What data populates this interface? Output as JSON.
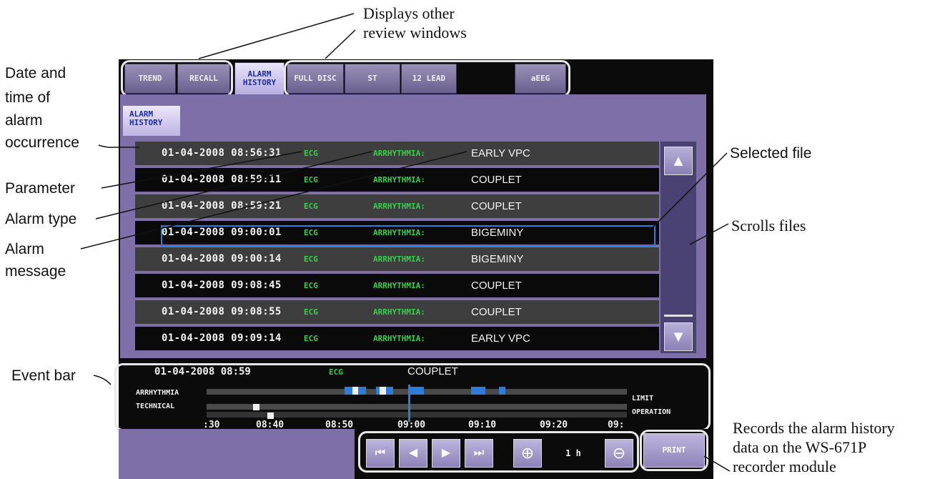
{
  "callouts": {
    "other_windows": [
      "Displays other",
      "review windows"
    ],
    "datetime": [
      "Date and",
      "time of",
      "alarm",
      "occurrence"
    ],
    "parameter": "Parameter",
    "alarm_type": "Alarm type",
    "alarm_message": [
      "Alarm",
      "message"
    ],
    "selected_file": "Selected file",
    "scrolls_files": "Scrolls files",
    "event_bar": "Event bar",
    "records": [
      "Records the alarm history",
      "data on the WS-671P",
      "recorder module"
    ]
  },
  "tabs": [
    {
      "label": "TREND"
    },
    {
      "label": "RECALL"
    },
    {
      "label": "ALARM HISTORY",
      "active": true
    },
    {
      "label": "FULL DISC"
    },
    {
      "label": "ST"
    },
    {
      "label": "12 LEAD"
    },
    {
      "label": ""
    },
    {
      "label": "aEEG"
    }
  ],
  "subtab": {
    "label": "ALARM HISTORY"
  },
  "alarm_rows": [
    {
      "datetime": "01-04-2008 08:56:31",
      "parameter": "ECG",
      "type": "ARRHYTHMIA:",
      "message": "EARLY VPC"
    },
    {
      "datetime": "01-04-2008 08:59:11",
      "parameter": "ECG",
      "type": "ARRHYTHMIA:",
      "message": "COUPLET"
    },
    {
      "datetime": "01-04-2008 08:59:21",
      "parameter": "ECG",
      "type": "ARRHYTHMIA:",
      "message": "COUPLET"
    },
    {
      "datetime": "01-04-2008 09:00:01",
      "parameter": "ECG",
      "type": "ARRHYTHMIA:",
      "message": "BIGEMINY",
      "selected": true
    },
    {
      "datetime": "01-04-2008 09:00:14",
      "parameter": "ECG",
      "type": "ARRHYTHMIA:",
      "message": "BIGEMINY"
    },
    {
      "datetime": "01-04-2008 09:08:45",
      "parameter": "ECG",
      "type": "ARRHYTHMIA:",
      "message": "COUPLET"
    },
    {
      "datetime": "01-04-2008 09:08:55",
      "parameter": "ECG",
      "type": "ARRHYTHMIA:",
      "message": "COUPLET"
    },
    {
      "datetime": "01-04-2008 09:09:14",
      "parameter": "ECG",
      "type": "ARRHYTHMIA:",
      "message": "EARLY VPC"
    }
  ],
  "scroll": {
    "up_icon": "triangle-up-icon",
    "down_icon": "triangle-down-icon"
  },
  "event_bar": {
    "header_datetime": "01-04-2008 08:59",
    "header_parameter": "ECG",
    "header_message": "COUPLET",
    "lane_left": [
      "ARRHYTHMIA",
      "TECHNICAL"
    ],
    "lane_right": [
      "LIMIT",
      "OPERATION"
    ],
    "time_labels": [
      ":30",
      "08:40",
      "08:50",
      "09:00",
      "09:10",
      "09:20",
      "09:"
    ]
  },
  "controls": {
    "first_icon": "skip-to-start-icon",
    "prev_icon": "previous-icon",
    "next_icon": "next-icon",
    "last_icon": "skip-to-end-icon",
    "zoom_in_icon": "zoom-in-icon",
    "zoom_value": "1 h",
    "zoom_out_icon": "zoom-out-icon",
    "print_label": "PRINT"
  },
  "colors": {
    "panel_purple": "#7f6fa8",
    "param_green": "#33d24a",
    "selection_blue": "#2f7bd8",
    "event_blue": "#2f7bd8"
  }
}
